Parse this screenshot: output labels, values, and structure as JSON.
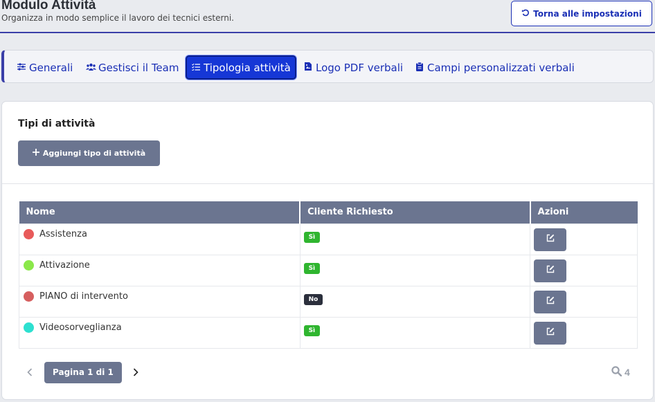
{
  "header": {
    "title": "Modulo Attività",
    "subtitle": "Organizza in modo semplice il lavoro dei tecnici esterni.",
    "back_label": "Torna alle impostazioni"
  },
  "tabs": [
    {
      "label": "Generali",
      "icon": "sliders-icon"
    },
    {
      "label": "Gestisci il Team",
      "icon": "users-icon"
    },
    {
      "label": "Tipologia attività",
      "icon": "list-check-icon",
      "active": true
    },
    {
      "label": "Logo PDF verbali",
      "icon": "file-image-icon"
    },
    {
      "label": "Campi personalizzati verbali",
      "icon": "clipboard-icon"
    }
  ],
  "section": {
    "title": "Tipi di attività",
    "add_label": "Aggiungi tipo di attività"
  },
  "table": {
    "headers": [
      "Nome",
      "Cliente Richiesto",
      "Azioni"
    ],
    "rows": [
      {
        "name": "Assistenza",
        "color": "#e85a5a",
        "required": "Sì"
      },
      {
        "name": "Attivazione",
        "color": "#8be84a",
        "required": "Sì"
      },
      {
        "name": "PIANO di intervento",
        "color": "#d65f5f",
        "required": "No"
      },
      {
        "name": "Videosorveglianza",
        "color": "#2de0d0",
        "required": "Sì"
      }
    ]
  },
  "pager": {
    "label": "Pagina 1 di 1",
    "count": "4"
  },
  "colors": {
    "accent": "#1637d6",
    "secondary": "#6b7590",
    "yes": "#2fb52f",
    "no": "#2b2f3c"
  }
}
